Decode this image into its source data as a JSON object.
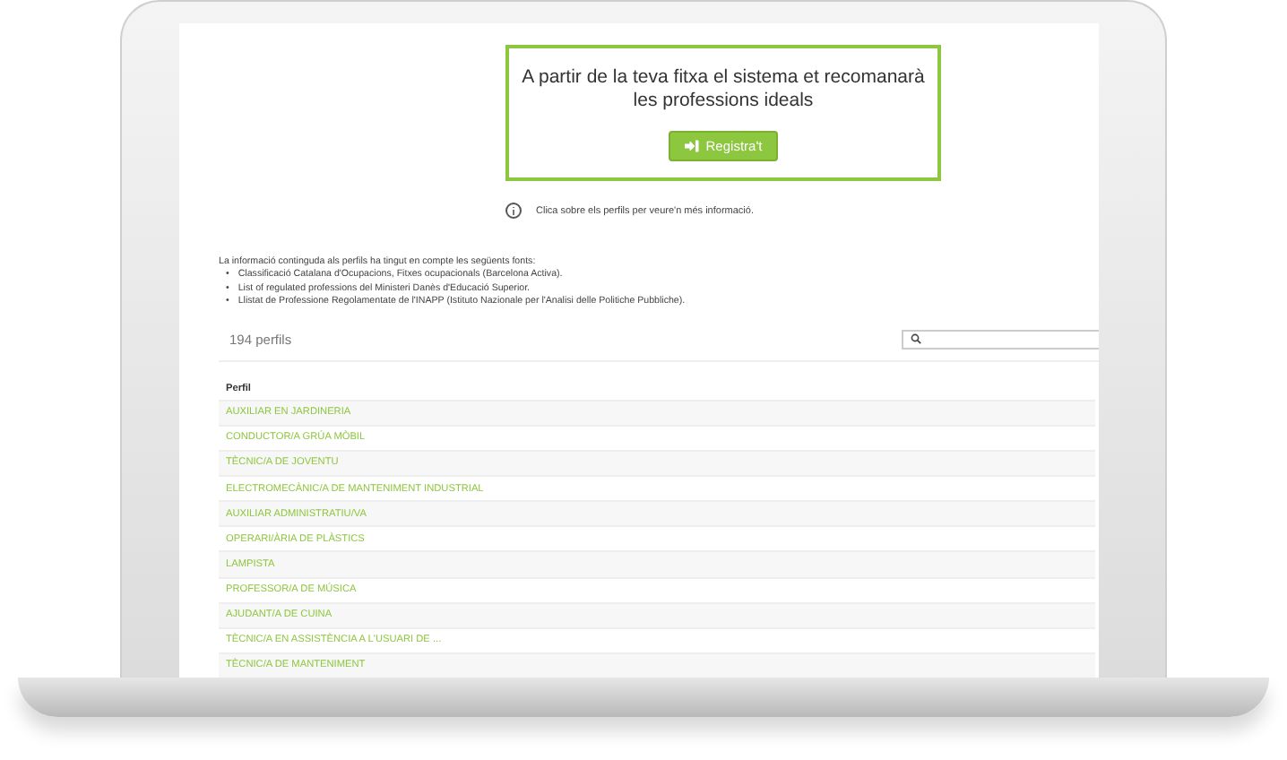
{
  "promo": {
    "text": "A partir de la teva fitxa el sistema et recomanarà les professions ideals",
    "button": "Registra't"
  },
  "info": "Clica sobre els perfils per veure'n més informació.",
  "sources": {
    "intro": "La informació continguda als perfils ha tingut en compte les següents fonts:",
    "items": [
      {
        "bullet": "•",
        "text": "Classificació Catalana d'Ocupacions, Fitxes ocupacionals (Barcelona Activa)."
      },
      {
        "bullet": "•",
        "text": "List of regulated professions del Ministeri Danès d'Educació Superior."
      },
      {
        "bullet": "•",
        "text": "Llistat de Professione Regolamentate de l'INAPP (Istituto Nazionale per l'Analisi delle Politiche Pubbliche)."
      }
    ]
  },
  "count": "194 perfils",
  "table": {
    "columns": [
      "Perfil"
    ],
    "rows": [
      "AUXILIAR EN JARDINERIA",
      "CONDUCTOR/A GRÚA MÒBIL",
      "TÈCNIC/A DE JOVENTU",
      "ELECTROMECÀNIC/A DE MANTENIMENT INDUSTRIAL",
      "AUXILIAR ADMINISTRATIU/VA",
      "OPERARI/ÀRIA DE PLÀSTICS",
      "LAMPISTA",
      "PROFESSOR/A DE MÚSICA",
      "AJUDANT/A DE CUINA",
      "TÈCNIC/A EN ASSISTÈNCIA A L'USUARI DE ...",
      "TÈCNIC/A DE MANTENIMENT"
    ]
  }
}
